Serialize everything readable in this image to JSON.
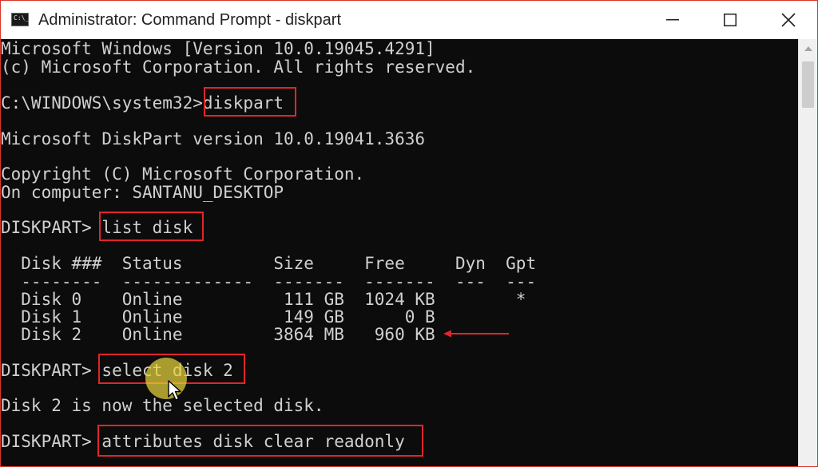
{
  "window": {
    "title": "Administrator: Command Prompt - diskpart",
    "icon": "cmd-icon",
    "icon_text": "C:\\_",
    "controls": [
      "minimize-icon",
      "maximize-icon",
      "close-icon"
    ]
  },
  "console": {
    "lines": [
      "Microsoft Windows [Version 10.0.19045.4291]",
      "(c) Microsoft Corporation. All rights reserved.",
      "C:\\WINDOWS\\system32>diskpart",
      "Microsoft DiskPart version 10.0.19041.3636",
      "Copyright (C) Microsoft Corporation.",
      "On computer: SANTANU_DESKTOP",
      "DISKPART> list disk",
      "  Disk ###  Status         Size     Free     Dyn  Gpt",
      "  --------  -------------  -------  -------  ---  ---",
      "  Disk 0    Online          111 GB  1024 KB        *",
      "  Disk 1    Online          149 GB      0 B",
      "  Disk 2    Online         3864 MB   960 KB",
      "DISKPART> select disk 2",
      "Disk 2 is now the selected disk.",
      "DISKPART> attributes disk clear readonly"
    ],
    "highlighted_commands": [
      "diskpart",
      "list disk",
      "select disk 2",
      "attributes disk clear readonly"
    ]
  },
  "colors": {
    "console_bg": "#0c0c0c",
    "console_text": "#d0d0d0",
    "highlight_border": "#e0262b",
    "cursor_highlight": "#e6d23c"
  }
}
